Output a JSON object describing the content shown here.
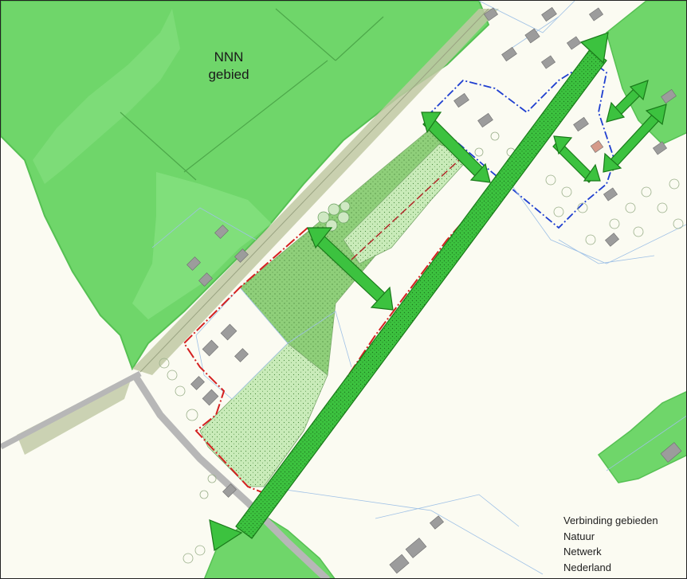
{
  "map": {
    "area_label_line1": "NNN",
    "area_label_line2": "gebied",
    "legend_lines": [
      "Verbinding gebieden",
      "Natuur",
      "Netwerk",
      "Nederland"
    ]
  },
  "colors": {
    "background": "#fbfbf2",
    "nnn_green": "#6fd66a",
    "nnn_dark_edge": "#56c053",
    "field_green": "#8fcf7a",
    "light_dotted_green": "#c9ebb9",
    "corridor_arrow": "#3cc23f",
    "corridor_outline": "#1a7a1a",
    "plan_boundary_red": "#d42020",
    "plan_boundary_blue": "#1f3fd0",
    "road_grey": "#b7b7b7",
    "building_grey": "#9c9c9c",
    "parcel_line_blue": "#9fc1e6",
    "rail_olive": "#bfc8a3"
  },
  "icons": {
    "corridor": "double-arrow-icon",
    "tree": "tree-icon",
    "building": "building-icon"
  }
}
